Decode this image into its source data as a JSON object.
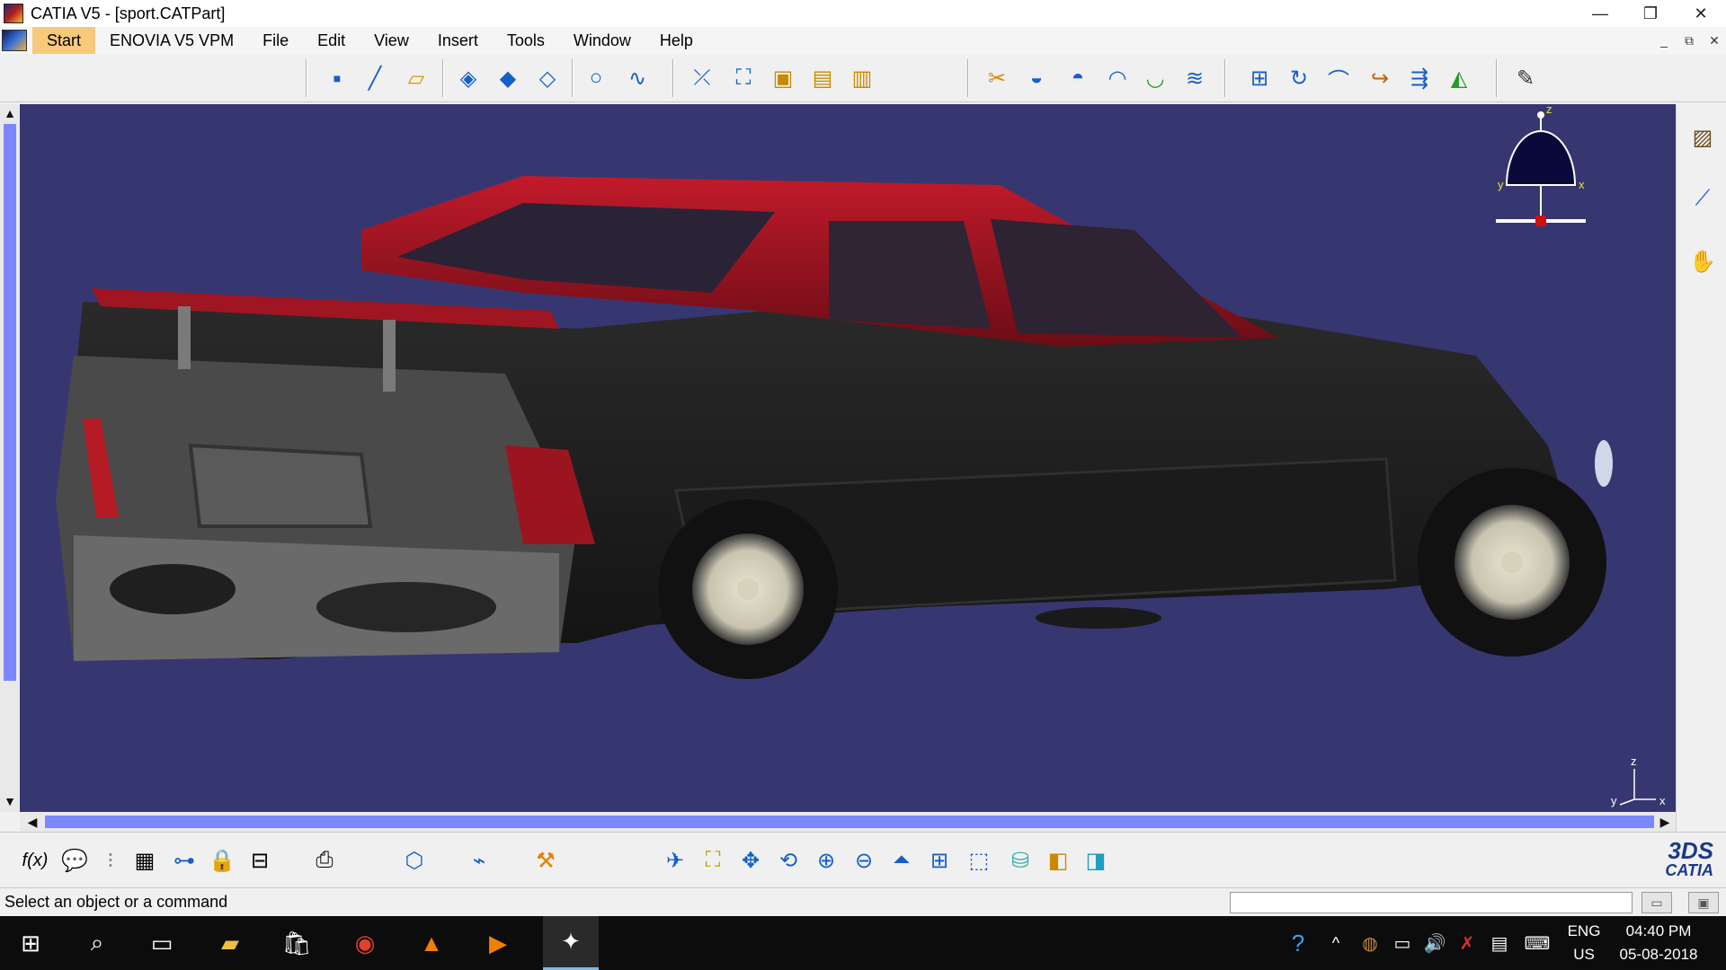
{
  "window": {
    "title": "CATIA V5 - [sport.CATPart]",
    "minimize": "—",
    "restore": "❐",
    "close": "✕"
  },
  "menu": {
    "items": [
      "Start",
      "ENOVIA V5 VPM",
      "File",
      "Edit",
      "View",
      "Insert",
      "Tools",
      "Window",
      "Help"
    ],
    "mdi_minimize": "_",
    "mdi_restore": "⧉",
    "mdi_close": "✕"
  },
  "viewport": {
    "background": "#363770",
    "compass_labels": {
      "z": "z",
      "x": "x",
      "y": "y"
    },
    "axis_labels": {
      "z": "z",
      "x": "x",
      "y": "y"
    }
  },
  "toolbar_top_icons": [
    "point-icon",
    "line-icon",
    "plane-icon",
    "extrude-surface-icon",
    "revolve-surface-icon",
    "sweep-icon",
    "circle-icon",
    "spline-icon",
    "intersection-icon",
    "projection-icon",
    "boundary-icon",
    "fill-icon",
    "join-icon",
    "trim-icon",
    "split-icon",
    "offset-icon",
    "blend-icon",
    "fillet-icon",
    "extract-icon",
    "translate-icon",
    "rotate-icon",
    "symmetry-icon",
    "scale-icon",
    "affinity-icon",
    "sketch-icon"
  ],
  "toolbar_bottom_icons": [
    "formula-icon",
    "comment-icon",
    "reference-icon",
    "table-icon",
    "tree-icon",
    "lock-icon",
    "parameter-icon",
    "measure-icon",
    "material-icon",
    "analysis-icon",
    "apply-material-icon",
    "fly-icon",
    "fit-all-icon",
    "pan-icon",
    "rotate-view-icon",
    "zoom-in-icon",
    "zoom-out-icon",
    "normal-view-icon",
    "multi-view-icon",
    "iso-view-icon",
    "shading-icon",
    "hide-show-icon",
    "swap-visible-icon"
  ],
  "catia_logo": {
    "mark": "3DS",
    "name": "CATIA"
  },
  "status": {
    "message": "Select an object or a command",
    "command_value": ""
  },
  "taskbar": {
    "lang": "ENG",
    "region": "US",
    "time": "04:40 PM",
    "date": "05-08-2018"
  }
}
